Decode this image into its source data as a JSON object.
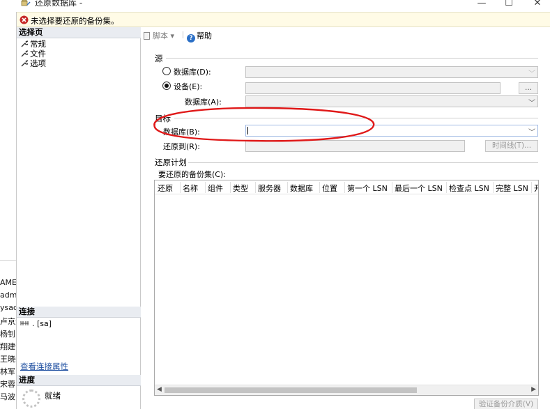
{
  "window": {
    "title": "还原数据库 -",
    "minimize": "—",
    "maximize": "☐",
    "close": "✕"
  },
  "error_bar": {
    "message": "未选择要还原的备份集。",
    "icon": "error-x-icon"
  },
  "background_app": {
    "items": [
      "AME",
      "admin",
      "ysad",
      "卢京光",
      "杨钊",
      "翔建伟",
      "王晓委",
      "林军",
      "宋蓉",
      "马波"
    ]
  },
  "left_panel": {
    "select_page_header": "选择页",
    "pages": [
      {
        "label": "常规",
        "icon": "wrench-icon"
      },
      {
        "label": "文件",
        "icon": "wrench-icon"
      },
      {
        "label": "选项",
        "icon": "wrench-icon"
      }
    ],
    "connection_header": "连接",
    "connection_text": ". [sa]",
    "connection_icon": "server-connection-icon",
    "view_connection_properties": "查看连接属性",
    "progress_header": "进度",
    "progress_status": "就绪"
  },
  "toolbar": {
    "script_label": "脚本",
    "script_dropdown": "▾",
    "help_label": "帮助"
  },
  "source": {
    "title": "源",
    "database_radio_label": "数据库(D):",
    "database_selected": false,
    "device_radio_label": "设备(E):",
    "device_selected": true,
    "device_value": "",
    "browse_button": "...",
    "device_database_label": "数据库(A):",
    "device_database_value": ""
  },
  "destination": {
    "title": "目标",
    "database_label": "数据库(B):",
    "database_value": "",
    "restore_to_label": "还原到(R):",
    "restore_to_value": "",
    "timeline_button": "时间线(T)..."
  },
  "restore_plan": {
    "title": "还原计划",
    "backup_sets_label": "要还原的备份集(C):",
    "columns": [
      "还原",
      "名称",
      "组件",
      "类型",
      "服务器",
      "数据库",
      "位置",
      "第一个 LSN",
      "最后一个 LSN",
      "检查点 LSN",
      "完整 LSN",
      "开"
    ],
    "rows": []
  },
  "verify_button": "验证备份介质(V)",
  "colors": {
    "annotation": "#e01919",
    "error_bar_bg": "#fffbe6",
    "link": "#1d4ea0",
    "section_header_bg": "#e9ecf1"
  }
}
